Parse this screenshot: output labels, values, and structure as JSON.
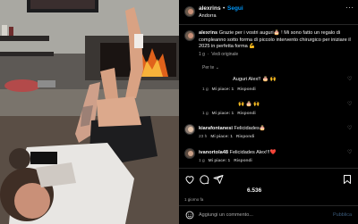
{
  "post": {
    "username": "alexrins",
    "follow_label": "Segui",
    "location": "Andorra",
    "more_label": "···",
    "caption_user": "alexrins",
    "caption_text": "Grazie per i vostri auguri🎂 ! Mi sono fatto un regalo di compleanno sotto forma di piccolo intervento chirurgico per iniziare il 2025 in perfetta forma 💪",
    "caption_time": "1 g",
    "see_translation": "Vedi originale",
    "translate_label": "Per te",
    "likes": "6.536",
    "date": "1 giorno fa"
  },
  "replies": [
    {
      "text": "Auguri Alex!! 🎂 🙌",
      "time": "1 g",
      "likes": "Mi piace: 1",
      "reply": "Rispondi"
    },
    {
      "text": "🙌 🎂 🙌",
      "time": "1 g",
      "likes": "Mi piace: 1",
      "reply": "Rispondi"
    }
  ],
  "comments": [
    {
      "user": "kiarafontanesi",
      "text": "Felicidades🎂",
      "time": "23 h",
      "likes": "Mi piace: 1",
      "reply": "Rispondi"
    },
    {
      "user": "ivanortola48",
      "text": "Felicidades Alex!!!❤️",
      "time": "1 g",
      "likes": "Mi piace: 1",
      "reply": "Rispondi"
    }
  ],
  "add_comment": {
    "placeholder": "Aggiungi un commento...",
    "publish_label": "Pubblica"
  },
  "icons": {
    "like": "heart-icon",
    "comment": "comment-icon",
    "share": "share-icon",
    "save": "bookmark-icon",
    "emoji": "emoji-icon"
  },
  "colors": {
    "background": "#000000",
    "text": "#f5f5f5",
    "secondary": "#a8a8a8",
    "follow": "#0095f6"
  }
}
